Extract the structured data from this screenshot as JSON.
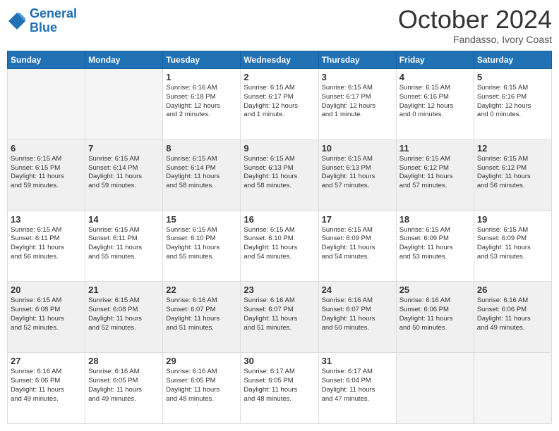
{
  "header": {
    "logo_line1": "General",
    "logo_line2": "Blue",
    "month": "October 2024",
    "location": "Fandasso, Ivory Coast"
  },
  "days_of_week": [
    "Sunday",
    "Monday",
    "Tuesday",
    "Wednesday",
    "Thursday",
    "Friday",
    "Saturday"
  ],
  "weeks": [
    [
      {
        "day": "",
        "text": ""
      },
      {
        "day": "",
        "text": ""
      },
      {
        "day": "1",
        "text": "Sunrise: 6:16 AM\nSunset: 6:18 PM\nDaylight: 12 hours\nand 2 minutes."
      },
      {
        "day": "2",
        "text": "Sunrise: 6:15 AM\nSunset: 6:17 PM\nDaylight: 12 hours\nand 1 minute."
      },
      {
        "day": "3",
        "text": "Sunrise: 6:15 AM\nSunset: 6:17 PM\nDaylight: 12 hours\nand 1 minute."
      },
      {
        "day": "4",
        "text": "Sunrise: 6:15 AM\nSunset: 6:16 PM\nDaylight: 12 hours\nand 0 minutes."
      },
      {
        "day": "5",
        "text": "Sunrise: 6:15 AM\nSunset: 6:16 PM\nDaylight: 12 hours\nand 0 minutes."
      }
    ],
    [
      {
        "day": "6",
        "text": "Sunrise: 6:15 AM\nSunset: 6:15 PM\nDaylight: 11 hours\nand 59 minutes."
      },
      {
        "day": "7",
        "text": "Sunrise: 6:15 AM\nSunset: 6:14 PM\nDaylight: 11 hours\nand 59 minutes."
      },
      {
        "day": "8",
        "text": "Sunrise: 6:15 AM\nSunset: 6:14 PM\nDaylight: 11 hours\nand 58 minutes."
      },
      {
        "day": "9",
        "text": "Sunrise: 6:15 AM\nSunset: 6:13 PM\nDaylight: 11 hours\nand 58 minutes."
      },
      {
        "day": "10",
        "text": "Sunrise: 6:15 AM\nSunset: 6:13 PM\nDaylight: 11 hours\nand 57 minutes."
      },
      {
        "day": "11",
        "text": "Sunrise: 6:15 AM\nSunset: 6:12 PM\nDaylight: 11 hours\nand 57 minutes."
      },
      {
        "day": "12",
        "text": "Sunrise: 6:15 AM\nSunset: 6:12 PM\nDaylight: 11 hours\nand 56 minutes."
      }
    ],
    [
      {
        "day": "13",
        "text": "Sunrise: 6:15 AM\nSunset: 6:11 PM\nDaylight: 11 hours\nand 56 minutes."
      },
      {
        "day": "14",
        "text": "Sunrise: 6:15 AM\nSunset: 6:11 PM\nDaylight: 11 hours\nand 55 minutes."
      },
      {
        "day": "15",
        "text": "Sunrise: 6:15 AM\nSunset: 6:10 PM\nDaylight: 11 hours\nand 55 minutes."
      },
      {
        "day": "16",
        "text": "Sunrise: 6:15 AM\nSunset: 6:10 PM\nDaylight: 11 hours\nand 54 minutes."
      },
      {
        "day": "17",
        "text": "Sunrise: 6:15 AM\nSunset: 6:09 PM\nDaylight: 11 hours\nand 54 minutes."
      },
      {
        "day": "18",
        "text": "Sunrise: 6:15 AM\nSunset: 6:09 PM\nDaylight: 11 hours\nand 53 minutes."
      },
      {
        "day": "19",
        "text": "Sunrise: 6:15 AM\nSunset: 6:09 PM\nDaylight: 11 hours\nand 53 minutes."
      }
    ],
    [
      {
        "day": "20",
        "text": "Sunrise: 6:15 AM\nSunset: 6:08 PM\nDaylight: 11 hours\nand 52 minutes."
      },
      {
        "day": "21",
        "text": "Sunrise: 6:15 AM\nSunset: 6:08 PM\nDaylight: 11 hours\nand 52 minutes."
      },
      {
        "day": "22",
        "text": "Sunrise: 6:16 AM\nSunset: 6:07 PM\nDaylight: 11 hours\nand 51 minutes."
      },
      {
        "day": "23",
        "text": "Sunrise: 6:16 AM\nSunset: 6:07 PM\nDaylight: 11 hours\nand 51 minutes."
      },
      {
        "day": "24",
        "text": "Sunrise: 6:16 AM\nSunset: 6:07 PM\nDaylight: 11 hours\nand 50 minutes."
      },
      {
        "day": "25",
        "text": "Sunrise: 6:16 AM\nSunset: 6:06 PM\nDaylight: 11 hours\nand 50 minutes."
      },
      {
        "day": "26",
        "text": "Sunrise: 6:16 AM\nSunset: 6:06 PM\nDaylight: 11 hours\nand 49 minutes."
      }
    ],
    [
      {
        "day": "27",
        "text": "Sunrise: 6:16 AM\nSunset: 6:06 PM\nDaylight: 11 hours\nand 49 minutes."
      },
      {
        "day": "28",
        "text": "Sunrise: 6:16 AM\nSunset: 6:05 PM\nDaylight: 11 hours\nand 49 minutes."
      },
      {
        "day": "29",
        "text": "Sunrise: 6:16 AM\nSunset: 6:05 PM\nDaylight: 11 hours\nand 48 minutes."
      },
      {
        "day": "30",
        "text": "Sunrise: 6:17 AM\nSunset: 6:05 PM\nDaylight: 11 hours\nand 48 minutes."
      },
      {
        "day": "31",
        "text": "Sunrise: 6:17 AM\nSunset: 6:04 PM\nDaylight: 11 hours\nand 47 minutes."
      },
      {
        "day": "",
        "text": ""
      },
      {
        "day": "",
        "text": ""
      }
    ]
  ]
}
